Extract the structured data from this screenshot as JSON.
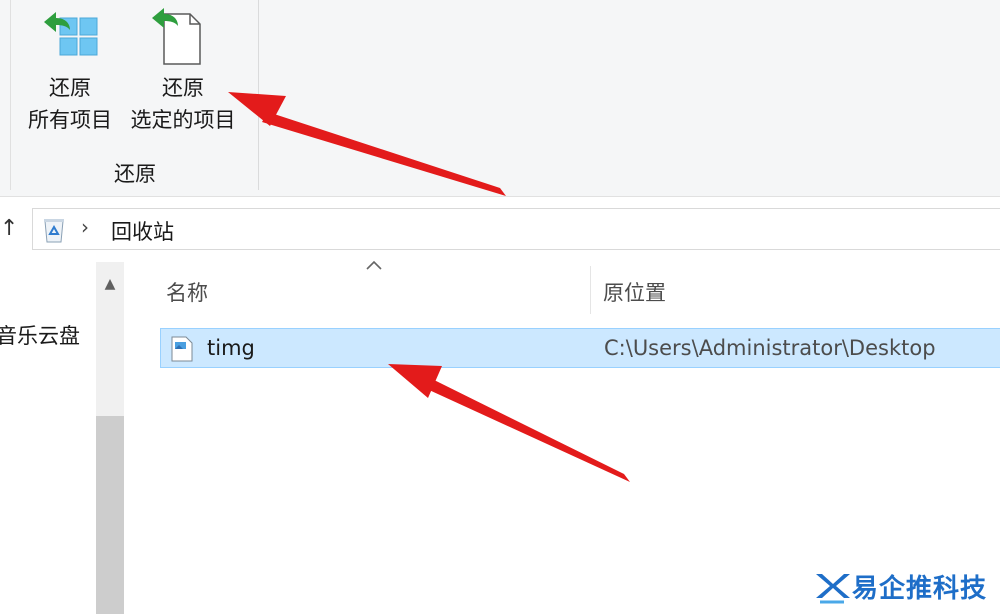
{
  "ribbon": {
    "restore_all": {
      "line1": "还原",
      "line2": "所有项目"
    },
    "restore_selected": {
      "line1": "还原",
      "line2": "选定的项目"
    },
    "group_label": "还原"
  },
  "nav": {
    "up_glyph": "↑"
  },
  "address": {
    "separator": "›",
    "crumb": "回收站"
  },
  "nav_pane": {
    "item": "音乐云盘"
  },
  "columns": {
    "name": "名称",
    "original_location": "原位置"
  },
  "rows": [
    {
      "name": "timg",
      "original_location": "C:\\Users\\Administrator\\Desktop"
    }
  ],
  "watermark": {
    "text": "易企推科技"
  },
  "colors": {
    "arrow": "#e31b1b",
    "selection_bg": "#cce8ff",
    "selection_border": "#99d1ff",
    "restore_green": "#2e9e3e",
    "watermark": "#1e6ec8"
  }
}
